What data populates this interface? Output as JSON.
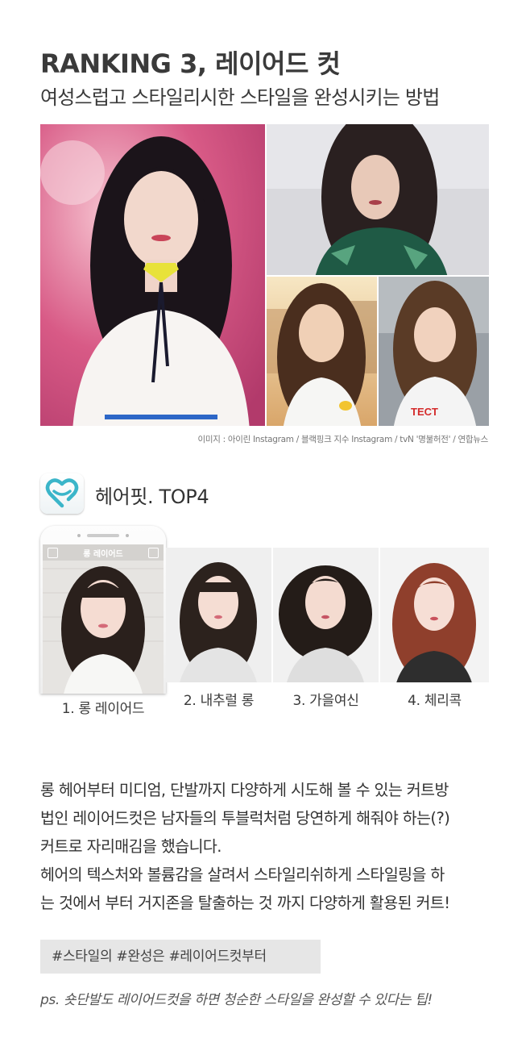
{
  "header": {
    "title": "RANKING 3, 레이어드 컷",
    "subtitle": "여성스럽고 스타일리시한 스타일을 완성시키는 방법"
  },
  "photos": {
    "credit": "이미지 : 아이린 Instagram / 블랙핑크 지수 Instagram / tvN '명불허전' / 연합뉴스",
    "shirt_text": "TECT"
  },
  "app": {
    "icon": "heart-icon",
    "title": "헤어핏. TOP4",
    "brand_color": "#3bb5c9"
  },
  "styles": [
    {
      "label": "1. 롱 레이어드"
    },
    {
      "label": "2. 내추럴 롱"
    },
    {
      "label": "3. 가을여신"
    },
    {
      "label": "4. 체리콕"
    }
  ],
  "phone_screen": {
    "header_label": "롱 레이어드"
  },
  "body": {
    "lines": [
      "롱 헤어부터 미디엄, 단발까지 다양하게 시도해 볼 수 있는 커트방",
      "법인 레이어드컷은 남자들의 투블럭처럼 당연하게 해줘야 하는(?)",
      "커트로 자리매김을 했습니다.",
      "헤어의 텍스처와 볼륨감을 살려서 스타일리쉬하게 스타일링을 하",
      "는 것에서 부터 거지존을 탈출하는 것 까지 다양하게 활용된 커트!"
    ]
  },
  "tags": "#스타일의  #완성은  #레이어드컷부터",
  "ps": "ps. 숏단발도 레이어드컷을 하면 청순한 스타일을 완성할 수 있다는 팁!"
}
